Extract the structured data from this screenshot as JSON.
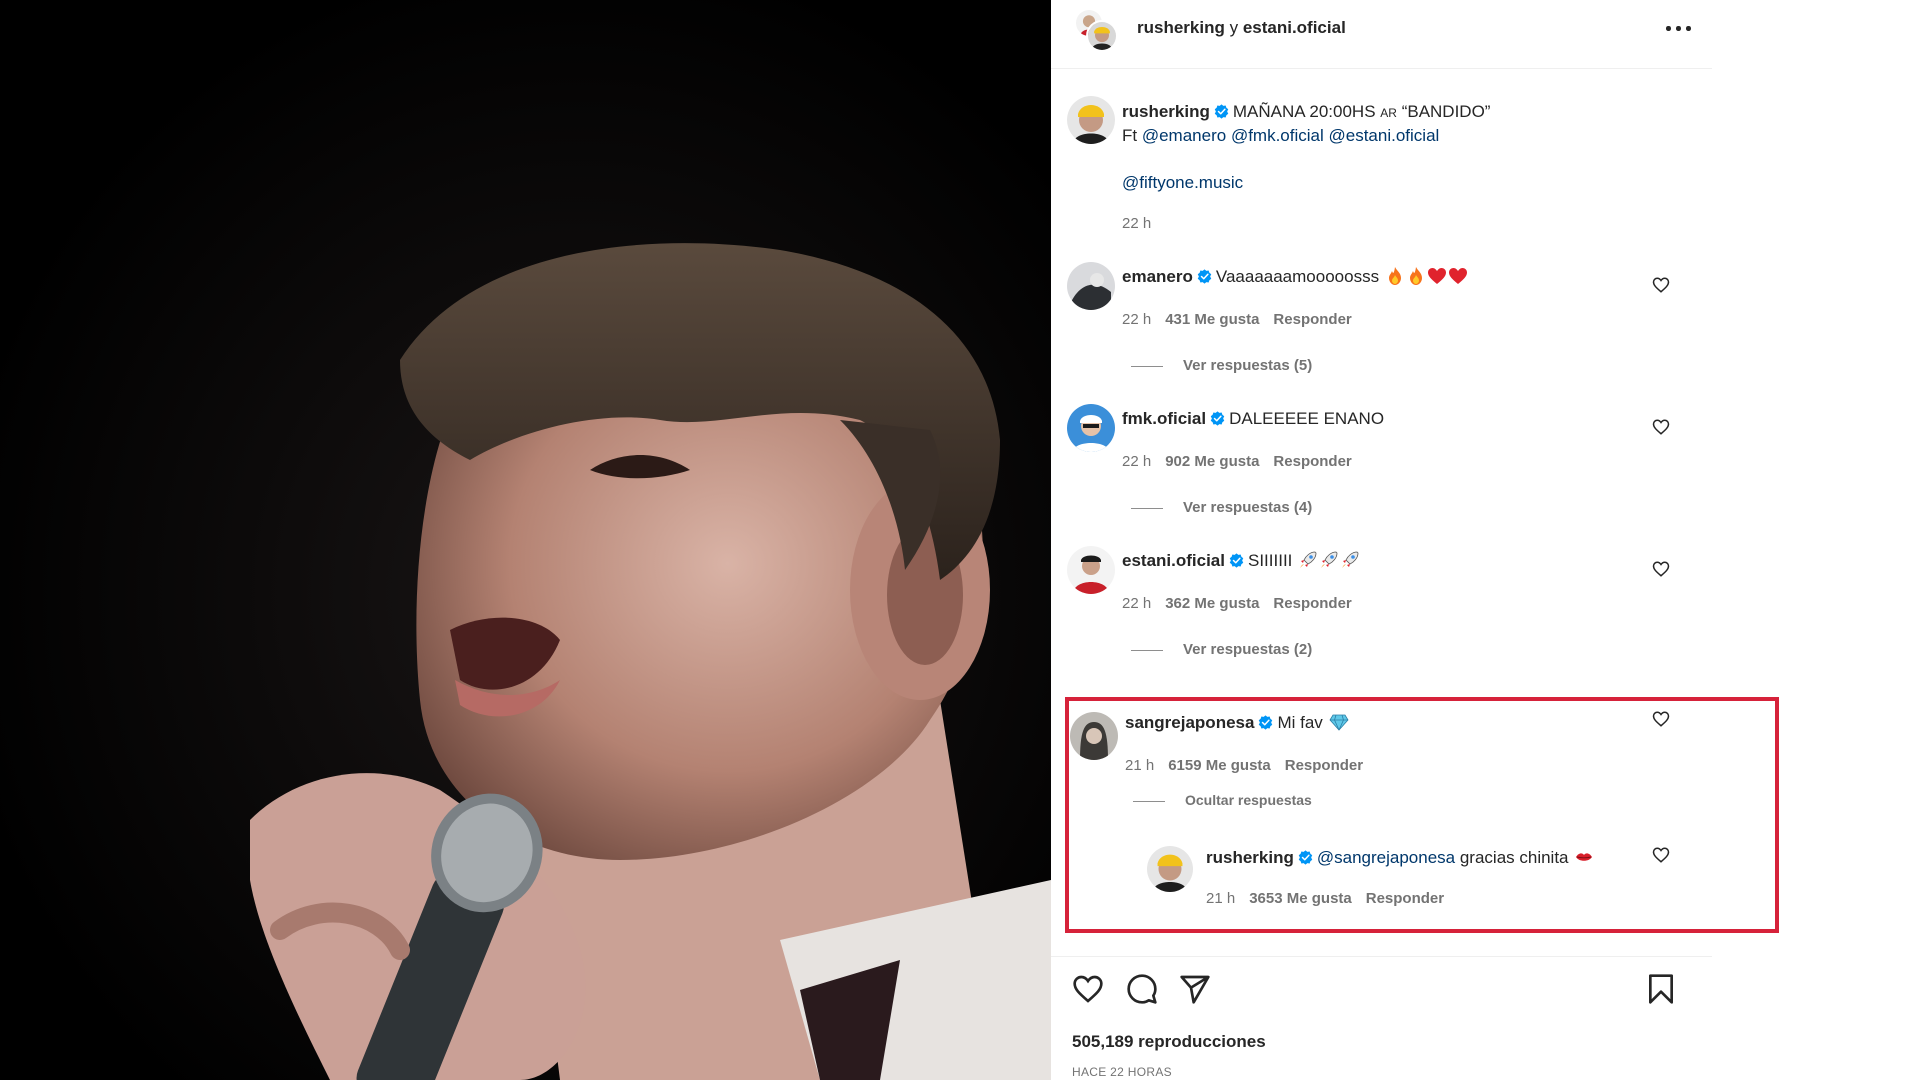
{
  "header": {
    "user1": "rusherking",
    "joiner": " y ",
    "user2": "estani.oficial"
  },
  "caption": {
    "username": "rusherking",
    "text_main": "MAÑANA 20:00HS",
    "text_ar": "AR",
    "text_title": "“BANDIDO”",
    "ft": "Ft",
    "mentions": [
      "@emanero",
      "@fmk.oficial",
      "@estani.oficial"
    ],
    "mention_label": "@fiftyone.music",
    "time": "22 h"
  },
  "comments": [
    {
      "username": "emanero",
      "text": "Vaaaaaaamooooosss",
      "emojis": [
        "fire",
        "fire",
        "red-heart",
        "red-heart"
      ],
      "time": "22 h",
      "likes": "431 Me gusta",
      "reply": "Responder",
      "replies_toggle": "Ver respuestas (5)"
    },
    {
      "username": "fmk.oficial",
      "text": "DALEEEEE ENANO",
      "emojis": [],
      "time": "22 h",
      "likes": "902 Me gusta",
      "reply": "Responder",
      "replies_toggle": "Ver respuestas (4)"
    },
    {
      "username": "estani.oficial",
      "text": "SIIIIIII",
      "emojis": [
        "rocket",
        "rocket",
        "rocket"
      ],
      "time": "22 h",
      "likes": "362 Me gusta",
      "reply": "Responder",
      "replies_toggle": "Ver respuestas (2)"
    },
    {
      "username": "sangrejaponesa",
      "text": "Mi fav",
      "emojis": [
        "gem"
      ],
      "time": "21 h",
      "likes": "6159 Me gusta",
      "reply": "Responder",
      "replies_toggle": "Ocultar respuestas"
    }
  ],
  "reply": {
    "username": "rusherking",
    "mention": "@sangrejaponesa",
    "text": "gracias chinita",
    "emojis": [
      "kiss-lips"
    ],
    "time": "21 h",
    "likes": "3653 Me gusta",
    "reply": "Responder"
  },
  "footer": {
    "views": "505,189 reproducciones",
    "timeago": "HACE 22 HORAS"
  },
  "colors": {
    "highlight": "#d6223a",
    "verified": "#0095f6",
    "mention": "#00376b",
    "muted": "#737373"
  },
  "icons": [
    "more-options-icon",
    "heart-icon",
    "comment-icon",
    "share-icon",
    "bookmark-icon",
    "verified-badge-icon"
  ]
}
